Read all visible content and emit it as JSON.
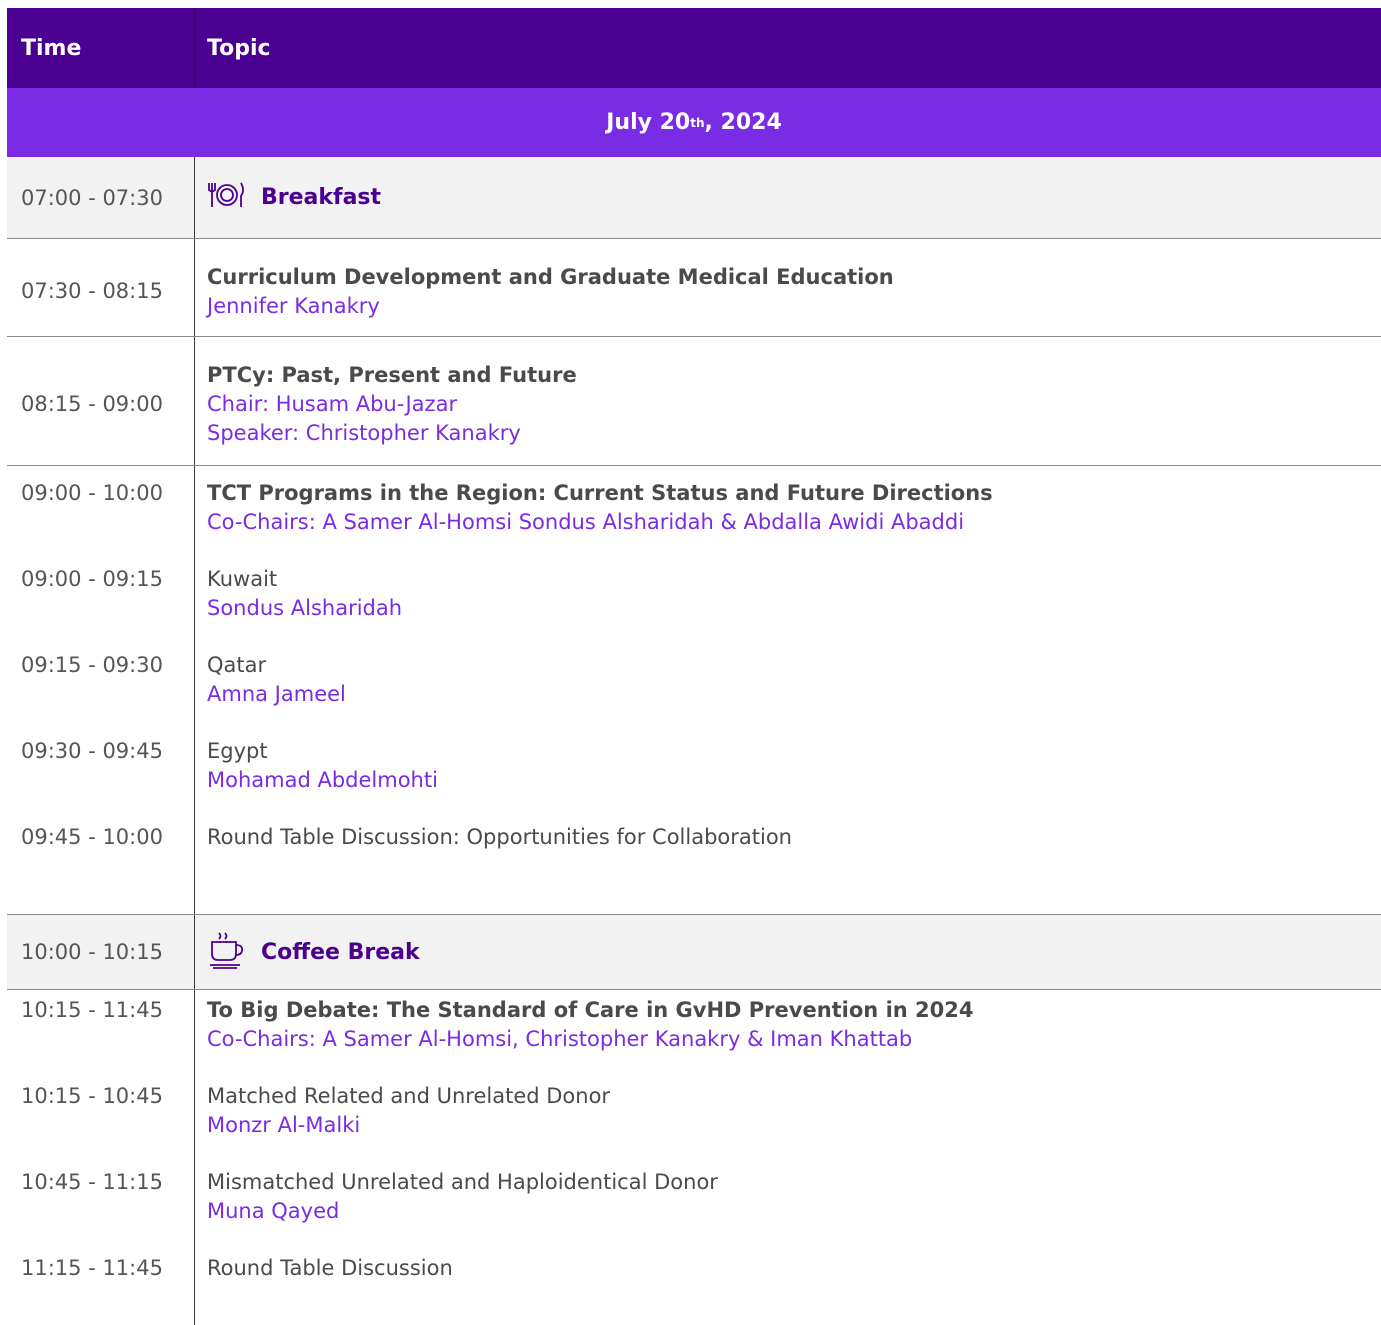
{
  "header": {
    "time_label": "Time",
    "topic_label": "Topic"
  },
  "day": {
    "label": "July 20",
    "suffix": "th",
    "year": ", 2024"
  },
  "rows": [
    {
      "time": "07:00 - 07:30",
      "title": "Breakfast",
      "icon": "dining-plate-icon"
    },
    {
      "time": "07:30 - 08:15",
      "title": "Curriculum Development and Graduate Medical Education",
      "speaker": "Jennifer Kanakry"
    },
    {
      "time": "08:15 - 09:00",
      "title": "PTCy: Past, Present and Future",
      "chair": "Chair: Husam Abu-Jazar",
      "speaker": "Speaker: Christopher Kanakry"
    },
    {
      "time": "09:00 - 10:00",
      "title": "TCT Programs in the Region: Current Status and Future Directions",
      "chairs": "Co-Chairs: A Samer Al-Homsi Sondus Alsharidah & Abdalla Awidi Abaddi"
    },
    {
      "time": "09:00 - 09:15",
      "title": "Kuwait",
      "speaker": "Sondus  Alsharidah"
    },
    {
      "time": "09:15 - 09:30",
      "title": "Qatar",
      "speaker": "Amna Jameel"
    },
    {
      "time": "09:30 - 09:45",
      "title": "Egypt",
      "speaker": "Mohamad Abdelmohti"
    },
    {
      "time": "09:45 - 10:00",
      "title": "Round Table Discussion: Opportunities for Collaboration"
    },
    {
      "time": "10:00 - 10:15",
      "title": "Coffee Break",
      "icon": "coffee-cup-icon"
    },
    {
      "time": "10:15 - 11:45",
      "title": "To Big Debate: The Standard of Care in GvHD Prevention in 2024",
      "chairs": "Co-Chairs: A Samer Al-Homsi,  Christopher Kanakry & Iman Khattab"
    },
    {
      "time": "10:15 - 10:45",
      "title": "Matched Related and Unrelated Donor",
      "speaker": "Monzr Al-Malki"
    },
    {
      "time": "10:45 - 11:15",
      "title": "Mismatched Unrelated and Haploidentical Donor",
      "speaker": "Muna Qayed"
    },
    {
      "time": "11:15 - 11:45",
      "title": "Round Table Discussion"
    }
  ],
  "colors": {
    "header_bg": "#4a0090",
    "date_bg": "#7a2be4",
    "speaker": "#7a2be4",
    "break_bg": "#f2f2f2"
  }
}
